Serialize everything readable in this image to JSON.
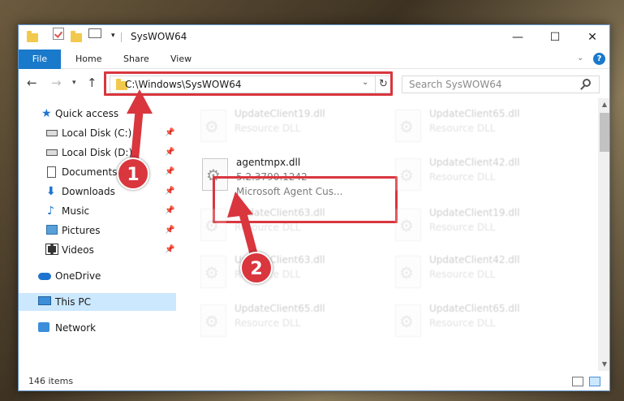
{
  "window": {
    "title": "SysWOW64",
    "minimize": "—",
    "maximize": "☐",
    "close": "✕"
  },
  "ribbon": {
    "tabs": [
      "File",
      "Home",
      "Share",
      "View"
    ]
  },
  "address": {
    "path": "C:\\Windows\\SysWOW64",
    "search_placeholder": "Search SysWOW64"
  },
  "sidebar": {
    "items": [
      {
        "label": "Quick access",
        "icon": "star-icon"
      },
      {
        "label": "Local Disk (C:)",
        "icon": "drive-icon"
      },
      {
        "label": "Local Disk (D:)",
        "icon": "drive-icon"
      },
      {
        "label": "Documents",
        "icon": "documents-icon"
      },
      {
        "label": "Downloads",
        "icon": "download-icon"
      },
      {
        "label": "Music",
        "icon": "music-icon"
      },
      {
        "label": "Pictures",
        "icon": "pictures-icon"
      },
      {
        "label": "Videos",
        "icon": "videos-icon"
      },
      {
        "label": "OneDrive",
        "icon": "cloud-icon"
      },
      {
        "label": "This PC",
        "icon": "computer-icon"
      },
      {
        "label": "Network",
        "icon": "network-icon"
      }
    ]
  },
  "files": [
    {
      "name": "UpdateClient19.dll",
      "type": "Resource DLL"
    },
    {
      "name": "UpdateClient65.dll",
      "type": "Resource DLL"
    },
    {
      "name": "agentmpx.dll",
      "version": "5.2.3790.1242",
      "description": "Microsoft Agent Cus..."
    },
    {
      "name": "UpdateClient42.dll",
      "type": "Resource DLL"
    },
    {
      "name": "UpdateClient63.dll",
      "type": "Resource DLL"
    },
    {
      "name": "UpdateClient19.dll",
      "type": "Resource DLL"
    },
    {
      "name": "UpdateClient63.dll",
      "type": "Resource DLL"
    },
    {
      "name": "UpdateClient42.dll",
      "type": "Resource DLL"
    },
    {
      "name": "UpdateClient65.dll",
      "type": "Resource DLL"
    },
    {
      "name": "UpdateClient65.dll",
      "type": "Resource DLL"
    }
  ],
  "status": {
    "item_count": "146 items"
  },
  "annotations": {
    "step1": "1",
    "step2": "2",
    "color": "#d9363e"
  }
}
